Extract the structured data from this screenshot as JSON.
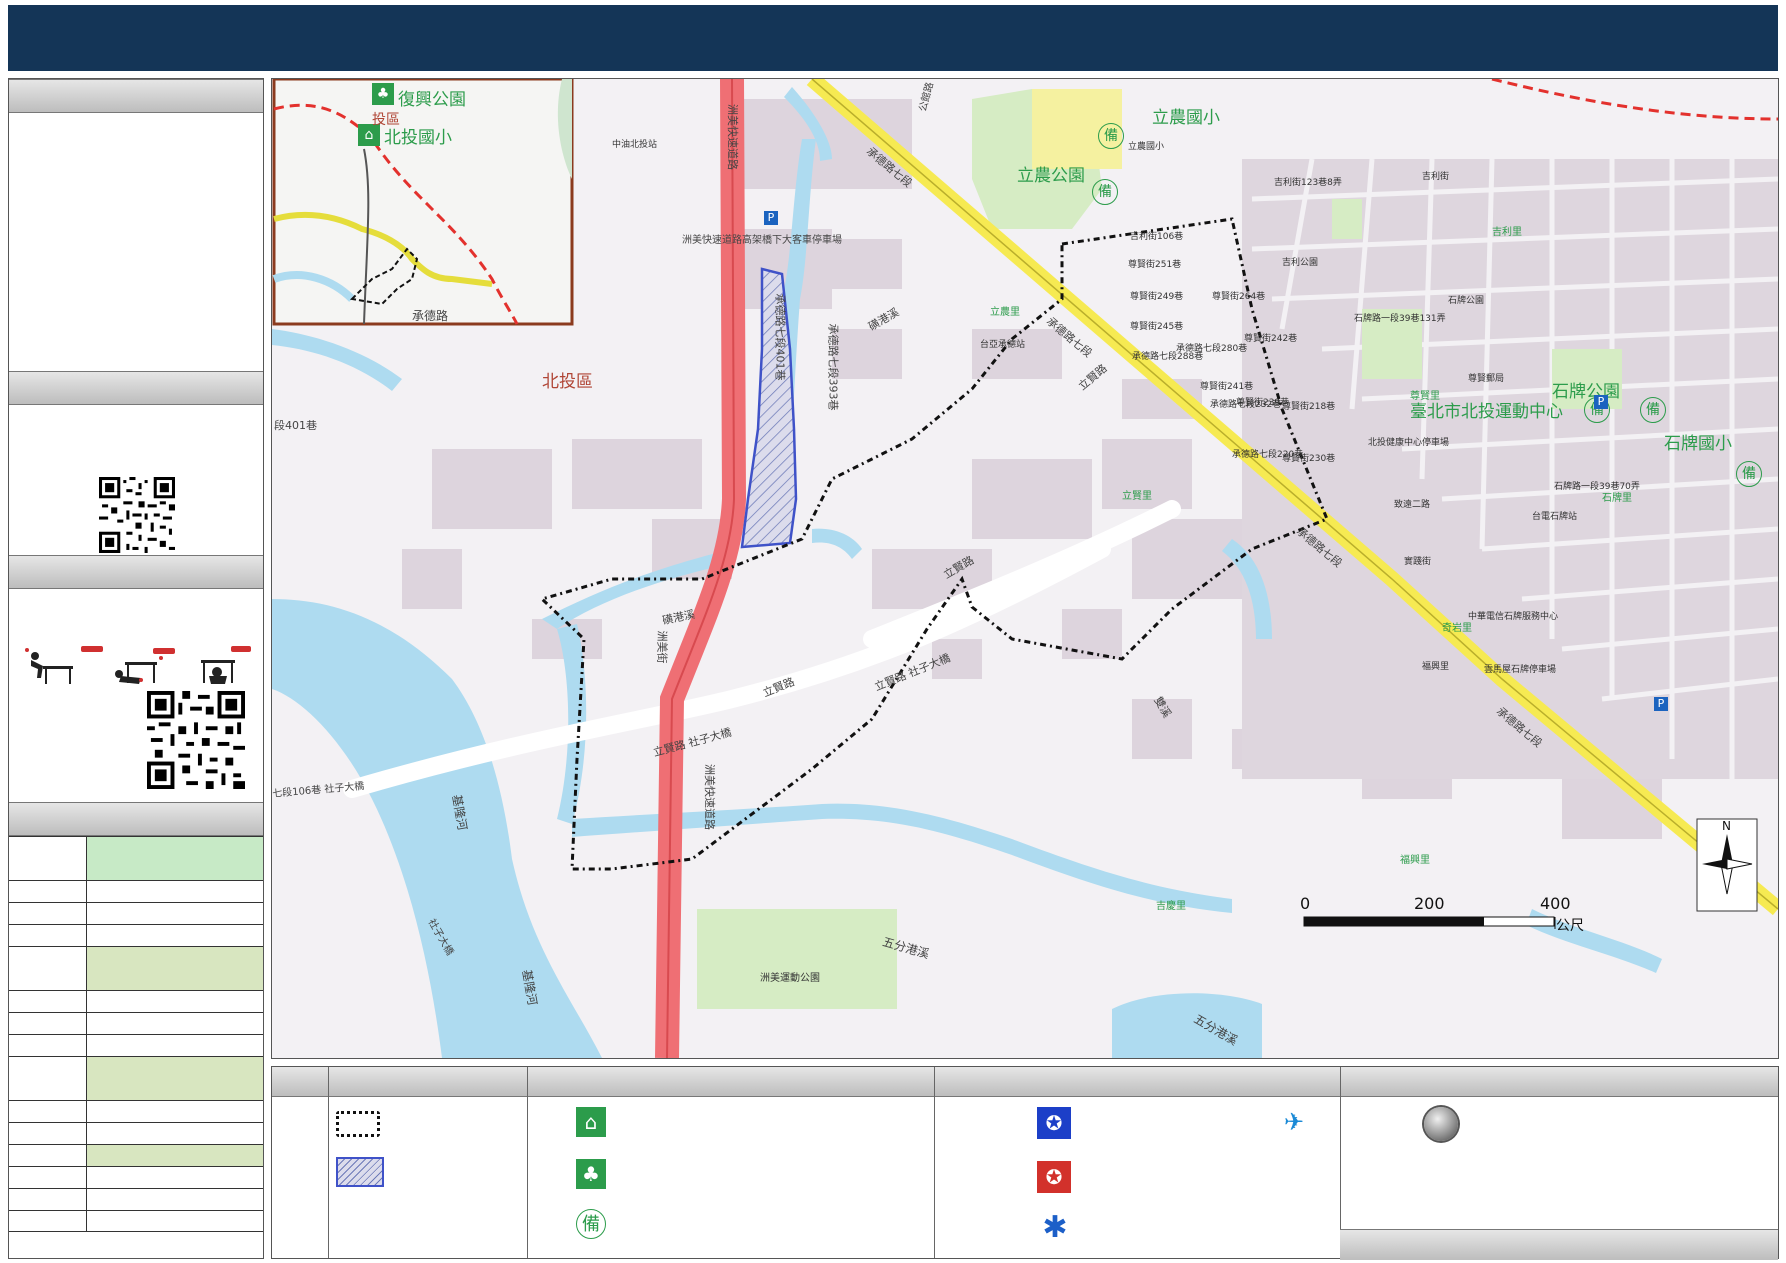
{
  "map": {
    "district": "北投區",
    "inset_labels": {
      "park": "復興公園",
      "school": "北投國小",
      "road": "承德路",
      "fragment": "投區"
    },
    "places": {
      "lishong_elem": "立農國小",
      "lishong_park": "立農公園",
      "shipai_park": "石牌公園",
      "shipai_elem": "石牌國小",
      "sports_center": "臺北市北投運動中心",
      "zhoumei_park": "洲美運動公園",
      "lixian_li": "立賢里",
      "linong_li": "立農里",
      "jiqing_li": "吉慶里",
      "fuxing_li": "福興里",
      "jili_li": "吉利里",
      "zunxian_li": "尊賢里",
      "shipai_li": "石牌里",
      "jingxian_li": "奇岩里"
    },
    "roads": {
      "chengde": "承德路七段",
      "lixian": "立賢路",
      "lixian_bridge": "立賢路 社子大橋",
      "zhoumei_expwy": "洲美快速道路",
      "zhoumei_st": "洲美街",
      "zhoumei_bridge_text": "洲美快速道路高架橋下大客車停車場",
      "lane401": "承德路七段401巷",
      "lane393": "承德路七段393巷",
      "alley": "段401巷",
      "lane106": "七段106巷 社子大橋",
      "xiangang": "磺港溪",
      "wufen": "五分港溪",
      "keelung": "基隆河",
      "shezi": "社子大橋",
      "shuangxi": "雙溪",
      "gongguan": "公館路",
      "lane": "承德路七段401巷",
      "xian_st": "立賢路"
    },
    "small_labels": [
      "中油北投站",
      "立農國小",
      "吉利街106巷",
      "尊賢街251巷",
      "尊賢街249巷",
      "尊賢街245巷",
      "承德路七段288巷",
      "承德路七段280巷",
      "尊賢街264巷",
      "尊賢街242巷",
      "尊賢街241巷",
      "尊賢街239巷",
      "承德路七段232巷",
      "承德路七段220巷",
      "尊賢街230巷",
      "尊賢街218巷",
      "石牌路一段39巷131弄",
      "致遠二路",
      "實踐街",
      "吉利街",
      "石牌路一段39巷70弄",
      "吉利街123巷8弄",
      "吉利公園",
      "尊賢郵局",
      "台亞承德站",
      "北投健康中心停車場",
      "福興里",
      "石牌公園",
      "台電石牌站",
      "中華電信石牌服務中心",
      "雲馬屋石牌停車場"
    ],
    "scale": {
      "zero": "0",
      "mid": "200",
      "max": "400",
      "unit": "公尺"
    },
    "north": "N"
  },
  "legend_icons": [
    "evacuation-shelter",
    "evacuation-park",
    "standby-icon",
    "police",
    "fire",
    "ambulance",
    "helicopter",
    "circle-point"
  ],
  "colors": {
    "header": "#143557",
    "water": "#aedbf0",
    "expressway": "#ef6f74",
    "primary_road": "#f6ea52",
    "green": "#d6ecc4",
    "boundary": "#111111",
    "district_line": "#e3312d"
  }
}
